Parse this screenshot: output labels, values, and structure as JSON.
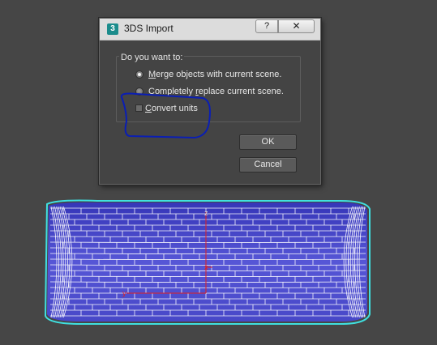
{
  "dialog": {
    "title": "3DS Import",
    "app_icon": "3",
    "help_label": "?",
    "close_label": "✕",
    "group_label": "Do you want to:",
    "options": {
      "merge": {
        "pre": "",
        "accel": "M",
        "post": "erge objects with current scene.",
        "selected": true
      },
      "replace": {
        "pre": "Completely ",
        "accel": "r",
        "post": "eplace current scene.",
        "selected": false
      }
    },
    "convert_units": {
      "pre": "",
      "accel": "C",
      "post": "onvert units",
      "checked": false
    },
    "ok_label": "OK",
    "cancel_label": "Cancel"
  },
  "viewport": {
    "axis_labels": {
      "z": "z",
      "x": "x",
      "y": "y"
    },
    "colors": {
      "background": "#464646",
      "mesh_fill": "#4f4fd0",
      "wire": "#ffffff",
      "selection_outline": "#3fe0e0",
      "axis": "#e02020",
      "annotation": "#0a1eb4"
    }
  }
}
